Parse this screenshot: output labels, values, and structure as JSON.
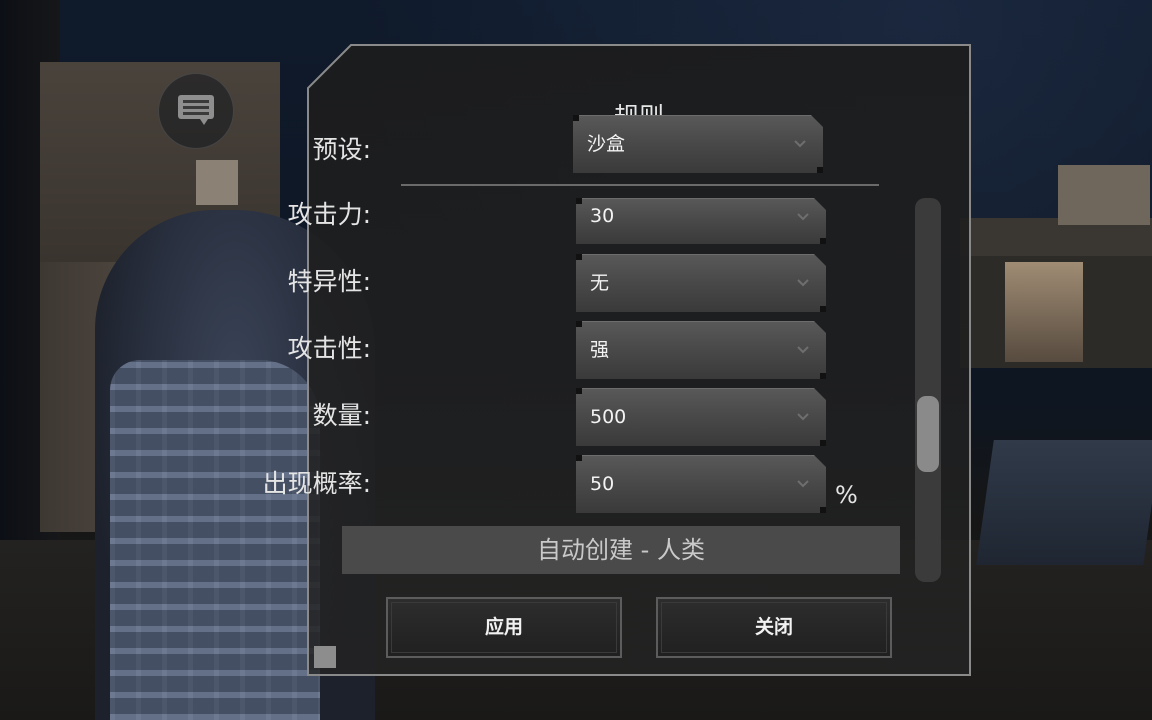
{
  "dialog": {
    "title": "规则",
    "preset": {
      "label": "预设:",
      "value": "沙盒"
    },
    "rows": [
      {
        "label": "攻击力:",
        "value": "30"
      },
      {
        "label": "特异性:",
        "value": "无"
      },
      {
        "label": "攻击性:",
        "value": "强"
      },
      {
        "label": "数量:",
        "value": "500"
      },
      {
        "label": "出现概率:",
        "value": "50",
        "suffix": "%"
      }
    ],
    "auto_create_label": "自动创建 - 人类",
    "apply_label": "应用",
    "close_label": "关闭"
  },
  "hud": {
    "chat_icon": "chat-bubble-icon"
  }
}
